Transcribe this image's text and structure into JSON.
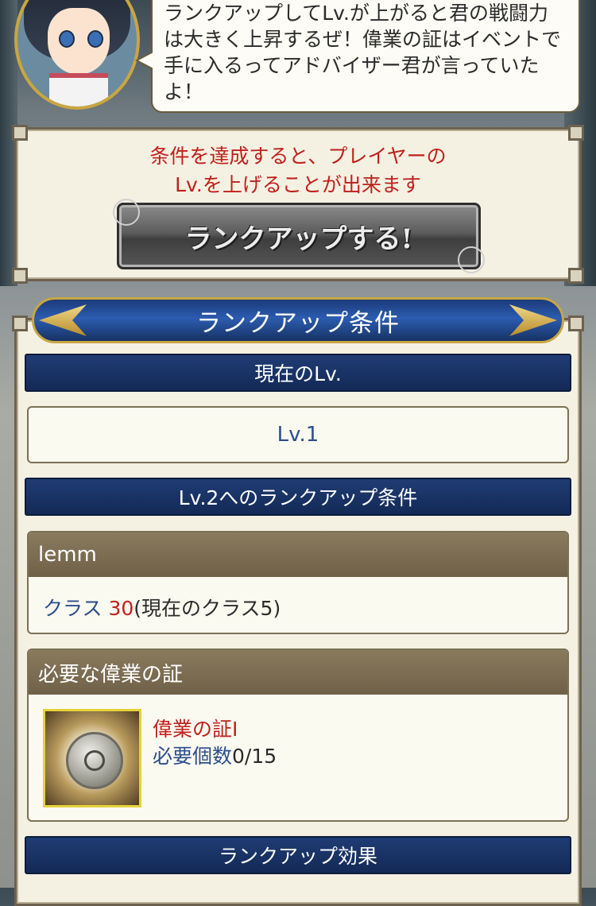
{
  "bubble": {
    "lines": [
      "ランクアップしてLv.が上がると君の戦闘力",
      "は大きく上昇するぜ！偉業の証はイベントで",
      "手に入るってアドバイザー君が言っていた",
      "よ！"
    ]
  },
  "rankup_panel": {
    "notice_line1": "条件を達成すると、プレイヤーの",
    "notice_line2": "Lv.を上げることが出来ます",
    "button_label": "ランクアップする!"
  },
  "conditions": {
    "banner_title": "ランクアップ条件",
    "current_level_header": "現在のLv.",
    "current_level_value": "Lv.1",
    "next_level_header": "Lv.2へのランクアップ条件",
    "player_name": "lemm",
    "class_label": "クラス",
    "class_required": "30",
    "class_current": "(現在のクラス5)",
    "required_items_header": "必要な偉業の証",
    "item_name": "偉業の証Ⅰ",
    "item_required_label": "必要個数",
    "item_required_value": "0/15",
    "effect_header": "ランクアップ効果"
  },
  "colors": {
    "accent_red": "#c0201b",
    "accent_blue": "#2c4d8c",
    "header_navy": "#1f3c74",
    "gold": "#c9a640"
  },
  "icons": {
    "avatar": "hestia-character-portrait",
    "item": "feat-medal-icon"
  }
}
